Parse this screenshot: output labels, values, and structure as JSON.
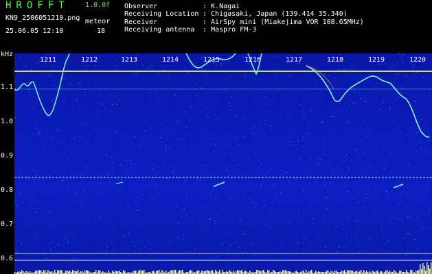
{
  "header": {
    "brand": "HROFFT",
    "version": "1.0.0f",
    "filename": "KN9_2506051210.png",
    "meteor_label": "meteor",
    "meteor_count": "18",
    "datetime": "25.06.05 12:10",
    "fields": [
      {
        "label": "Observer",
        "value": ": K.Nagai"
      },
      {
        "label": "Receiving Location",
        "value": ": Chigasaki, Japan (139.414 35.340)"
      },
      {
        "label": "Receiver",
        "value": ": AirSpy mini (Miakejima VOR 108.65MHz)"
      },
      {
        "label": "Receiving antenna",
        "value": ": Maspro FM-3"
      }
    ]
  },
  "axis": {
    "y_unit": "kHz",
    "y_ticks": [
      "1.1",
      "1.0",
      "0.9",
      "0.8",
      "0.7",
      "0.6"
    ],
    "x_ticks": [
      "1211",
      "1212",
      "1213",
      "1214",
      "1215",
      "1216",
      "1217",
      "1218",
      "1219",
      "1220"
    ]
  },
  "colors": {
    "background": "#0b1bb8",
    "trace": "#7fffd4",
    "bar": "#ffff33",
    "grid": "#ffffff"
  }
}
